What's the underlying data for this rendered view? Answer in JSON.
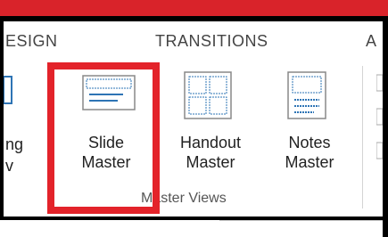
{
  "tabs": [
    {
      "label": "ESIGN"
    },
    {
      "label": "TRANSITIONS"
    },
    {
      "label": "A"
    }
  ],
  "ribbon": {
    "partial_left_label": "ng",
    "partial_left_label2": "v",
    "commands": [
      {
        "line1": "Slide",
        "line2": "Master"
      },
      {
        "line1": "Handout",
        "line2": "Master"
      },
      {
        "line1": "Notes",
        "line2": "Master"
      }
    ],
    "group_label": "Master Views"
  },
  "colors": {
    "highlight": "#e3232a",
    "top_bar": "#d9232a",
    "icon_blue": "#2e74b5"
  },
  "icons": [
    "slide-master-icon",
    "handout-master-icon",
    "notes-master-icon"
  ]
}
